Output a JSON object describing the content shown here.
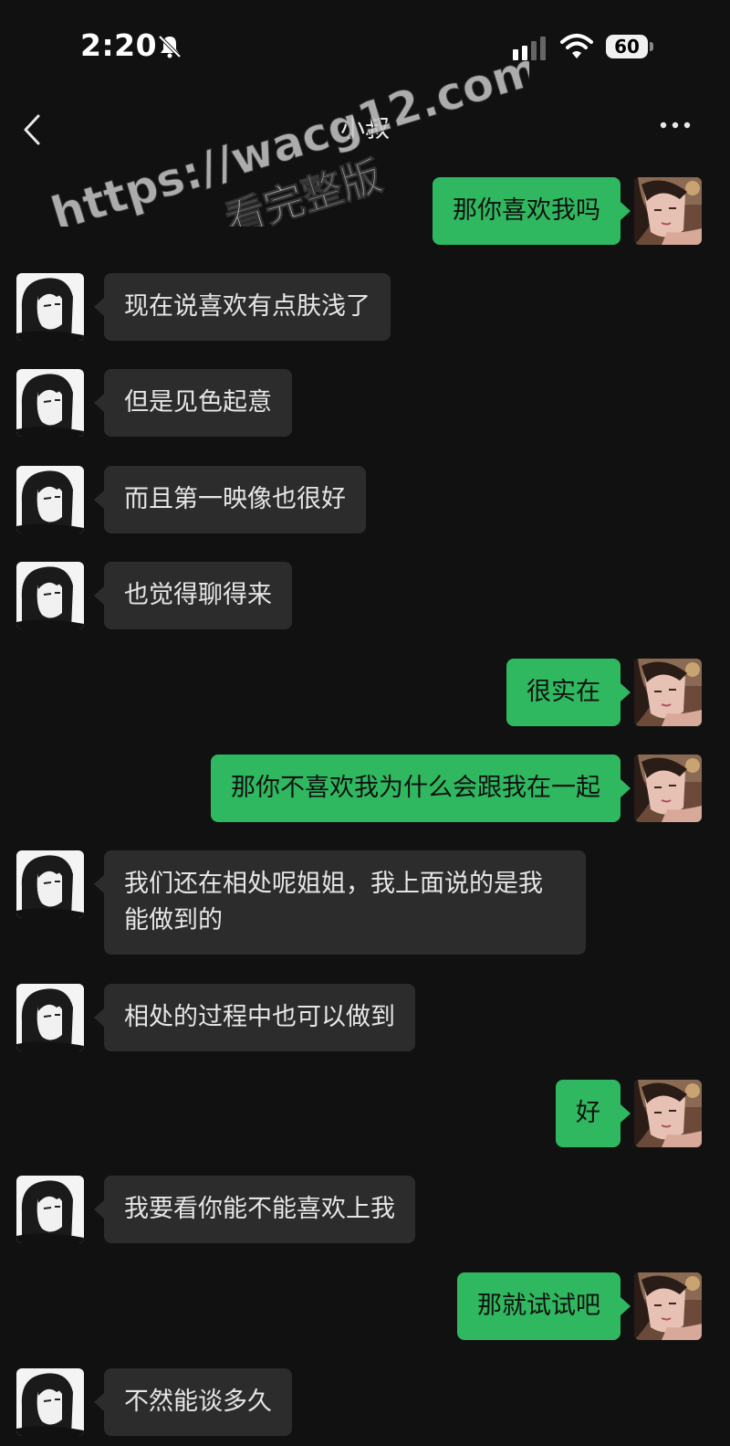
{
  "status_bar": {
    "time": "2:20",
    "battery": "60",
    "icons": [
      "bell-slash-icon",
      "signal-icon",
      "wifi-icon",
      "battery-icon"
    ]
  },
  "nav": {
    "title": "小叔",
    "icons": [
      "back-chevron-icon",
      "more-icon"
    ]
  },
  "watermark": {
    "line1": "https://wacg12.com",
    "line2": "看完整版"
  },
  "colors": {
    "background": "#111111",
    "incoming_bubble": "#2c2c2c",
    "outgoing_bubble": "#2fb85f"
  },
  "messages": [
    {
      "side": "right",
      "text": "那你喜欢我吗"
    },
    {
      "side": "left",
      "text": "现在说喜欢有点肤浅了"
    },
    {
      "side": "left",
      "text": "但是见色起意"
    },
    {
      "side": "left",
      "text": "而且第一映像也很好"
    },
    {
      "side": "left",
      "text": "也觉得聊得来"
    },
    {
      "side": "right",
      "text": "很实在"
    },
    {
      "side": "right",
      "text": "那你不喜欢我为什么会跟我在一起"
    },
    {
      "side": "left",
      "text": "我们还在相处呢姐姐，我上面说的是我能做到的"
    },
    {
      "side": "left",
      "text": "相处的过程中也可以做到"
    },
    {
      "side": "right",
      "text": "好"
    },
    {
      "side": "left",
      "text": "我要看你能不能喜欢上我"
    },
    {
      "side": "right",
      "text": "那就试试吧"
    },
    {
      "side": "left",
      "text": "不然能谈多久"
    }
  ]
}
